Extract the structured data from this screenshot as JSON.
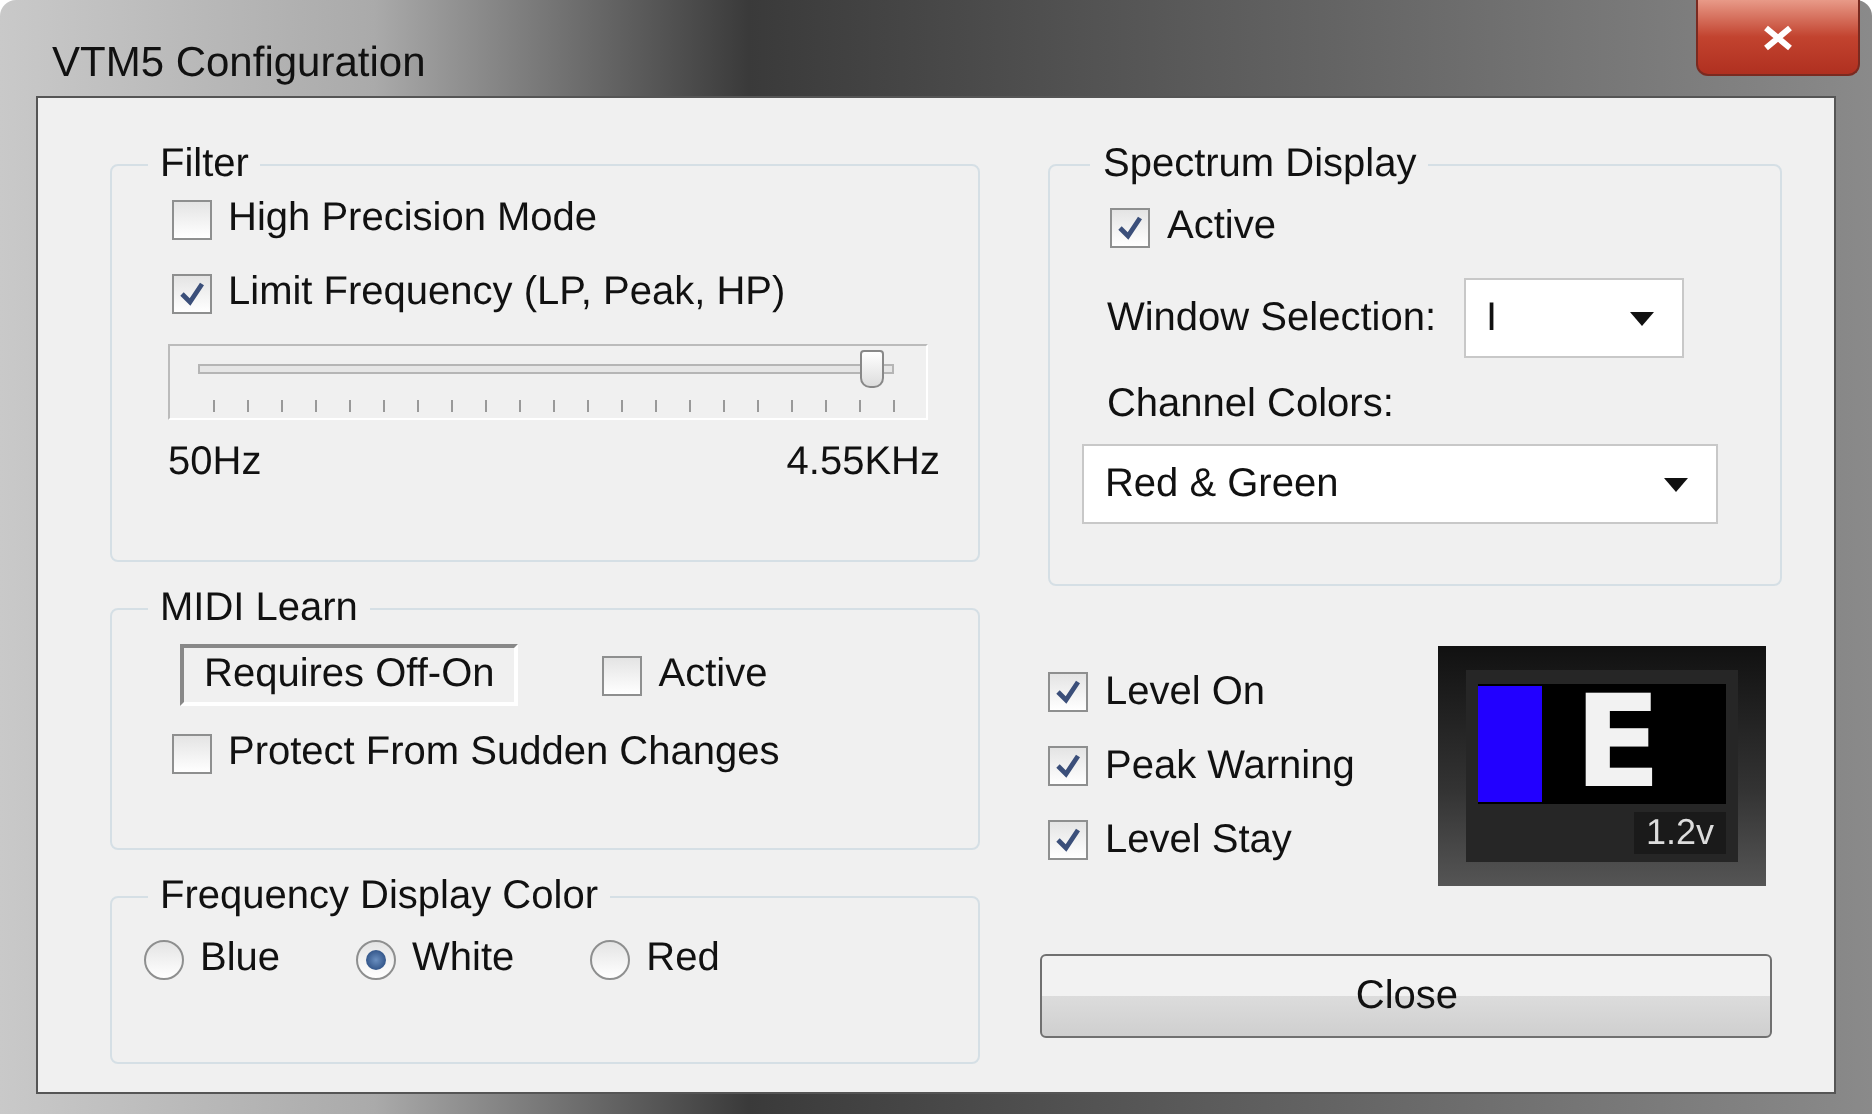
{
  "window": {
    "title": "VTM5 Configuration"
  },
  "filter": {
    "title": "Filter",
    "options": [
      {
        "label": "High Precision Mode",
        "checked": false
      },
      {
        "label": "Limit Frequency (LP, Peak, HP)",
        "checked": true
      }
    ],
    "slider": {
      "level": 0.98,
      "min_label": "50Hz",
      "max_label": "4.55KHz"
    }
  },
  "midi_learn": {
    "title": "MIDI Learn",
    "indicator": "Requires Off-On",
    "active": {
      "label": "Active",
      "checked": false
    },
    "protect": {
      "label": "Protect From Sudden Changes",
      "checked": false
    }
  },
  "frequency_display_color": {
    "title": "Frequency Display Color",
    "options": [
      {
        "label": "Blue",
        "selected": false
      },
      {
        "label": "White",
        "selected": true
      },
      {
        "label": "Red",
        "selected": false
      }
    ]
  },
  "spectrum_display": {
    "title": "Spectrum Display",
    "active": {
      "label": "Active",
      "checked": true
    },
    "window_selection": {
      "label": "Window Selection:",
      "value": "I"
    },
    "channel_colors": {
      "label": "Channel Colors:",
      "value": "Red & Green"
    }
  },
  "level_options": [
    {
      "label": "Level On",
      "checked": true
    },
    {
      "label": "Peak Warning",
      "checked": true
    },
    {
      "label": "Level Stay",
      "checked": true
    }
  ],
  "meter": {
    "letter": "E",
    "reading": "1.2v"
  },
  "buttons": [
    "Close"
  ]
}
